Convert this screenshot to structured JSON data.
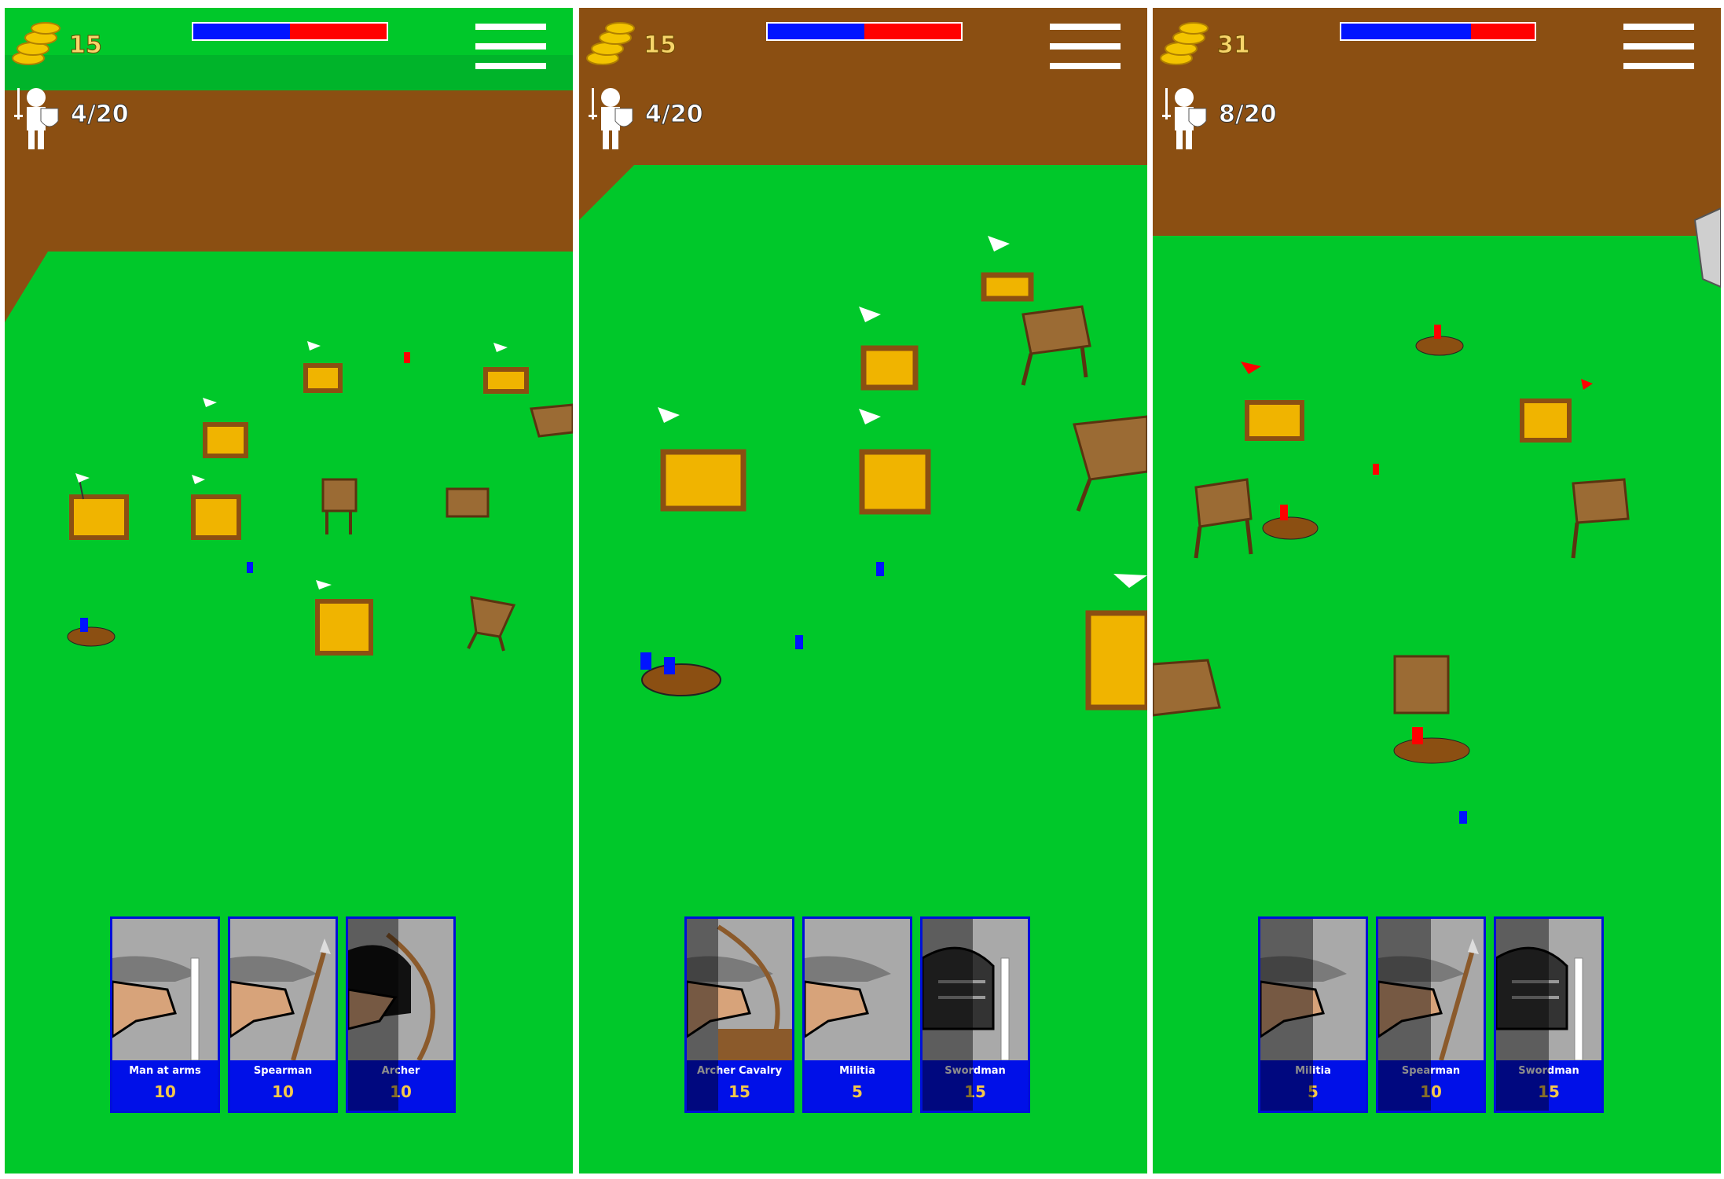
{
  "panels": [
    {
      "gold": "15",
      "population": "4/20",
      "health_blue_fraction": 0.5,
      "ground": "green",
      "cards": [
        {
          "name": "Man at arms",
          "cost": "10",
          "weapon": "sword",
          "helmet": "kettle-hat",
          "cooldown_fraction": 0
        },
        {
          "name": "Spearman",
          "cost": "10",
          "weapon": "spear",
          "helmet": "kettle-hat",
          "cooldown_fraction": 0
        },
        {
          "name": "Archer",
          "cost": "10",
          "weapon": "bow",
          "helmet": "hood",
          "cooldown_fraction": 0.48
        }
      ]
    },
    {
      "gold": "15",
      "population": "4/20",
      "health_blue_fraction": 0.5,
      "ground": "brown",
      "cards": [
        {
          "name": "Archer Cavalry",
          "cost": "15",
          "weapon": "bow",
          "helmet": "kettle-hat",
          "cooldown_fraction": 0.3
        },
        {
          "name": "Militia",
          "cost": "5",
          "weapon": "none",
          "helmet": "kettle-hat",
          "cooldown_fraction": 0
        },
        {
          "name": "Swordman",
          "cost": "15",
          "weapon": "sword",
          "helmet": "great-helm",
          "cooldown_fraction": 0.48
        }
      ]
    },
    {
      "gold": "31",
      "population": "8/20",
      "health_blue_fraction": 0.67,
      "ground": "brown",
      "cards": [
        {
          "name": "Militia",
          "cost": "5",
          "weapon": "none",
          "helmet": "kettle-hat",
          "cooldown_fraction": 0.5
        },
        {
          "name": "Spearman",
          "cost": "10",
          "weapon": "spear",
          "helmet": "kettle-hat",
          "cooldown_fraction": 0.5
        },
        {
          "name": "Swordman",
          "cost": "15",
          "weapon": "sword",
          "helmet": "great-helm",
          "cooldown_fraction": 0.5
        }
      ]
    }
  ],
  "colors": {
    "grass": "#00c82a",
    "dirt": "#8b4f12",
    "player_blue": "#0014ff",
    "enemy_red": "#ff0000",
    "card_border": "#0010d8",
    "gold_text": "#f7d56a"
  }
}
